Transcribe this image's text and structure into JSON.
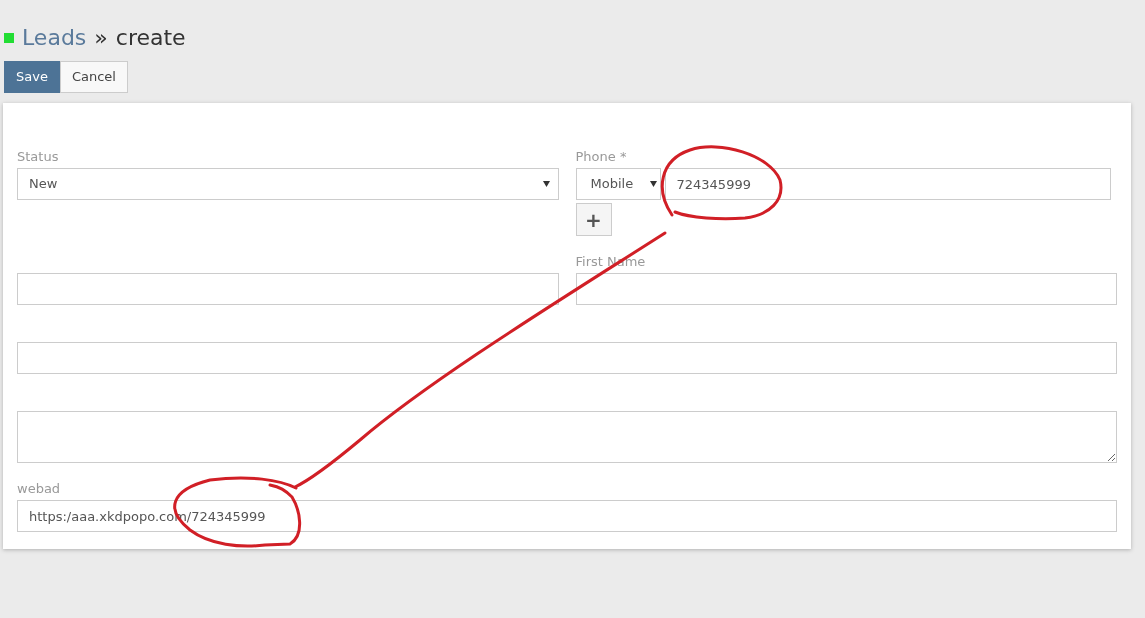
{
  "header": {
    "link": "Leads",
    "separator": "»",
    "current": "create"
  },
  "buttons": [
    {
      "label": "Save",
      "kind": "primary"
    },
    {
      "label": "Cancel",
      "kind": "default"
    }
  ],
  "form_rows": [
    [
      {
        "kind": "select",
        "label": "Status",
        "value": "New"
      },
      {
        "kind": "phone",
        "label": "Phone *",
        "type": "Mobile",
        "value": "724345999",
        "add": "+"
      }
    ],
    [
      {
        "kind": "text"
      },
      {
        "kind": "text",
        "label": "First Name"
      }
    ],
    [
      {
        "kind": "text"
      }
    ],
    [
      {
        "kind": "textarea"
      }
    ],
    [
      {
        "kind": "text",
        "label": "webad",
        "value": "https:/aaa.xkdpopo.com/724345999"
      }
    ]
  ]
}
